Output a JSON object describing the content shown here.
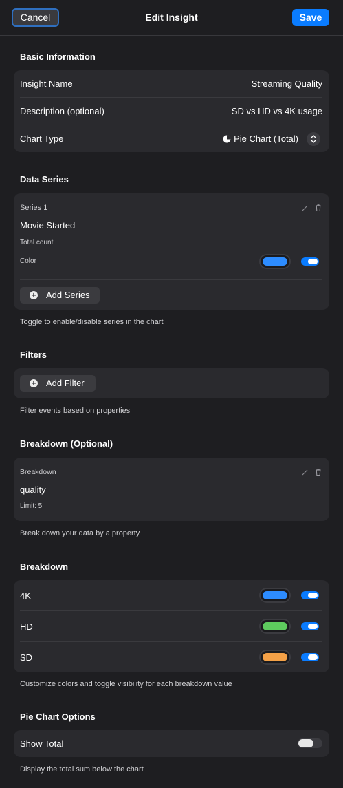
{
  "header": {
    "cancel_label": "Cancel",
    "title": "Edit Insight",
    "save_label": "Save"
  },
  "basic": {
    "section_title": "Basic Information",
    "name_label": "Insight Name",
    "name_value": "Streaming Quality",
    "description_label": "Description (optional)",
    "description_value": "SD vs HD vs 4K usage",
    "chart_type_label": "Chart Type",
    "chart_type_value": "Pie Chart (Total)",
    "chart_type_icon": "pie-chart-icon"
  },
  "data_series": {
    "section_title": "Data Series",
    "series": [
      {
        "header": "Series 1",
        "event": "Movie Started",
        "measure": "Total count",
        "color_label": "Color",
        "color": "#2d8cff",
        "enabled": true
      }
    ],
    "add_label": "Add Series",
    "hint": "Toggle to enable/disable series in the chart"
  },
  "filters": {
    "section_title": "Filters",
    "add_label": "Add Filter",
    "hint": "Filter events based on properties"
  },
  "breakdown_optional": {
    "section_title": "Breakdown (Optional)",
    "header": "Breakdown",
    "property": "quality",
    "limit": "Limit: 5",
    "hint": "Break down your data by a property"
  },
  "breakdown": {
    "section_title": "Breakdown",
    "items": [
      {
        "label": "4K",
        "color": "#2d8cff",
        "enabled": true
      },
      {
        "label": "HD",
        "color": "#5ecb5e",
        "enabled": true
      },
      {
        "label": "SD",
        "color": "#f4a147",
        "enabled": true
      }
    ],
    "hint": "Customize colors and toggle visibility for each breakdown value"
  },
  "pie_options": {
    "section_title": "Pie Chart Options",
    "show_total_label": "Show Total",
    "show_total_enabled": false,
    "hint": "Display the total sum below the chart"
  },
  "colors": {
    "accent": "#0a7cff",
    "background": "#1e1e21",
    "card": "#2a2a2e"
  }
}
